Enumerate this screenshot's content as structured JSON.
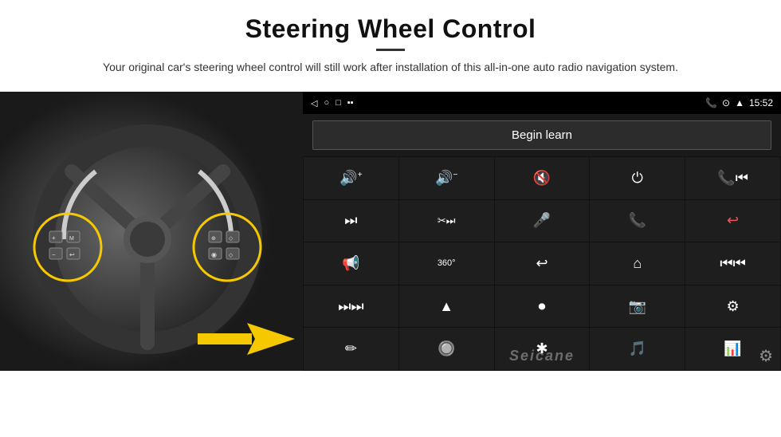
{
  "header": {
    "title": "Steering Wheel Control",
    "subtitle": "Your original car's steering wheel control will still work after installation of this all-in-one auto radio navigation system.",
    "divider": true
  },
  "radio": {
    "status_bar": {
      "back_icon": "◁",
      "home_icon": "○",
      "recents_icon": "□",
      "signal_icon": "▪▪",
      "phone_icon": "📞",
      "location_icon": "⊙",
      "wifi_icon": "▲",
      "time": "15:52"
    },
    "begin_learn_label": "Begin learn",
    "controls": [
      {
        "icon": "🔊+",
        "label": "vol-up"
      },
      {
        "icon": "🔊−",
        "label": "vol-down"
      },
      {
        "icon": "🔇",
        "label": "mute"
      },
      {
        "icon": "⏻",
        "label": "power"
      },
      {
        "icon": "⏮",
        "label": "prev-track-phone"
      },
      {
        "icon": "⏭",
        "label": "next-track"
      },
      {
        "icon": "✂⏭",
        "label": "next-seek"
      },
      {
        "icon": "🎤",
        "label": "mic"
      },
      {
        "icon": "📞",
        "label": "call"
      },
      {
        "icon": "↩",
        "label": "end-call"
      },
      {
        "icon": "📢",
        "label": "horn"
      },
      {
        "icon": "360°",
        "label": "360-cam"
      },
      {
        "icon": "↩",
        "label": "back"
      },
      {
        "icon": "⌂",
        "label": "home"
      },
      {
        "icon": "⏮⏮",
        "label": "fast-prev"
      },
      {
        "icon": "⏭⏭",
        "label": "fast-forward"
      },
      {
        "icon": "▲",
        "label": "navigation"
      },
      {
        "icon": "⏺",
        "label": "eject"
      },
      {
        "icon": "📷",
        "label": "camera"
      },
      {
        "icon": "⚙",
        "label": "settings-eq"
      },
      {
        "icon": "✏",
        "label": "stylus"
      },
      {
        "icon": "🔘",
        "label": "knob"
      },
      {
        "icon": "✱",
        "label": "bluetooth"
      },
      {
        "icon": "🎵",
        "label": "music"
      },
      {
        "icon": "📊",
        "label": "equalizer"
      }
    ],
    "watermark": "Seicane",
    "gear_icon": "⚙"
  }
}
